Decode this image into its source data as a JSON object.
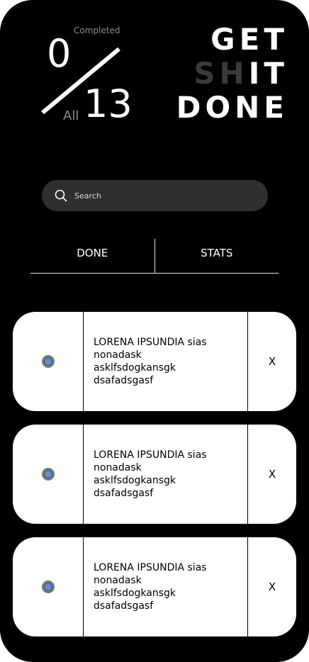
{
  "counter": {
    "completed_label": "Completed",
    "done": "0",
    "all_label": "All",
    "total": "13"
  },
  "title": {
    "line1": "GET",
    "line2_dim": "SH",
    "line2_rest": "IT",
    "line3": "DONE"
  },
  "search": {
    "placeholder": "Search",
    "value": ""
  },
  "tabs": [
    {
      "label": "DONE"
    },
    {
      "label": "STATS"
    }
  ],
  "tasks": [
    {
      "text": "LORENA IPSUNDIA sias\nnonadask\nasklfsdogkansgk\ndsafadsgasf",
      "delete_label": "X"
    },
    {
      "text": "LORENA IPSUNDIA sias\nnonadask\nasklfsdogkansgk\ndsafadsgasf",
      "delete_label": "X"
    },
    {
      "text": "LORENA IPSUNDIA sias\nnonadask\nasklfsdogkansgk\ndsafadsgasf",
      "delete_label": "X"
    }
  ],
  "colors": {
    "background": "#000000",
    "card": "#ffffff",
    "search_bg": "#2f2f2f",
    "dim_text": "#3a3a3a",
    "radio_fill": "#5b8fd6"
  }
}
